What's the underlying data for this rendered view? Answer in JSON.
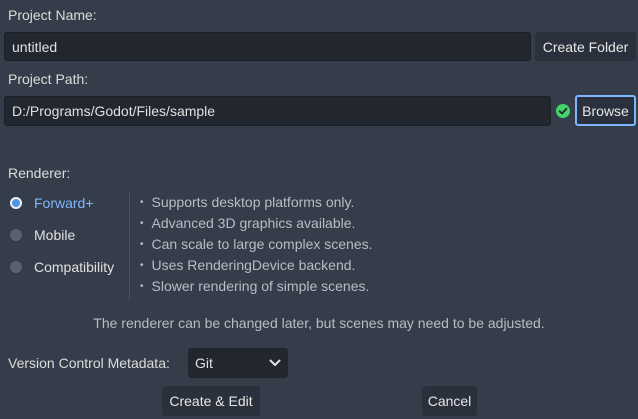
{
  "project_name": {
    "label": "Project Name:",
    "value": "untitled",
    "create_folder_label": "Create Folder"
  },
  "project_path": {
    "label": "Project Path:",
    "value": "D:/Programs/Godot/Files/sample",
    "browse_label": "Browse",
    "status_icon": "check-circle-icon",
    "status_color": "#44d36b"
  },
  "renderer": {
    "label": "Renderer:",
    "options": [
      {
        "label": "Forward+",
        "selected": true
      },
      {
        "label": "Mobile",
        "selected": false
      },
      {
        "label": "Compatibility",
        "selected": false
      }
    ],
    "features": [
      "Supports desktop platforms only.",
      "Advanced 3D graphics available.",
      "Can scale to large complex scenes.",
      "Uses RenderingDevice backend.",
      "Slower rendering of simple scenes."
    ],
    "note": "The renderer can be changed later, but scenes may need to be adjusted."
  },
  "version_control": {
    "label": "Version Control Metadata:",
    "selected": "Git"
  },
  "actions": {
    "create_edit_label": "Create & Edit",
    "cancel_label": "Cancel"
  },
  "colors": {
    "background": "#363d4a",
    "accent": "#7fb6ff",
    "success": "#44d36b"
  }
}
